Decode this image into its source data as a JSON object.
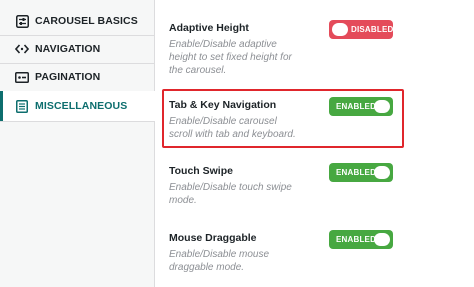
{
  "sidebar": {
    "items": [
      {
        "label": "CAROUSEL BASICS",
        "icon": "sliders-icon"
      },
      {
        "label": "NAVIGATION",
        "icon": "code-arrows-icon"
      },
      {
        "label": "PAGINATION",
        "icon": "pagination-icon"
      },
      {
        "label": "MISCELLANEOUS",
        "icon": "list-icon",
        "active": true
      }
    ]
  },
  "settings": [
    {
      "title": "Adaptive Height",
      "description": "Enable/Disable adaptive height to set fixed height for the carousel.",
      "toggle": "DISABLED",
      "state": "off"
    },
    {
      "title": "Tab & Key Navigation",
      "description": "Enable/Disable carousel scroll with tab and keyboard.",
      "toggle": "ENABLED",
      "state": "on"
    },
    {
      "title": "Touch Swipe",
      "description": "Enable/Disable touch swipe mode.",
      "toggle": "ENABLED",
      "state": "on"
    },
    {
      "title": "Mouse Draggable",
      "description": "Enable/Disable mouse draggable mode.",
      "toggle": "ENABLED",
      "state": "on"
    }
  ],
  "colors": {
    "accent": "#0d6e6e",
    "enabled": "#47a841",
    "disabled": "#e44b5a",
    "highlight": "#e0262c"
  }
}
